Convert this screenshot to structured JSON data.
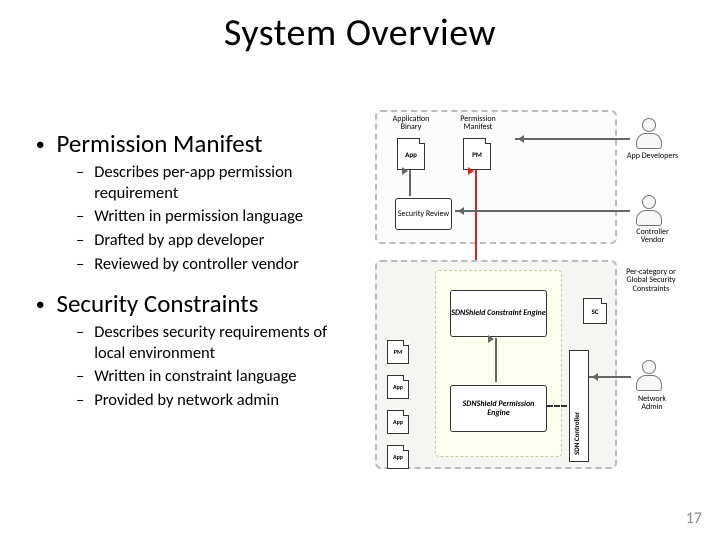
{
  "title": "System Overview",
  "sections": [
    {
      "heading": "Permission Manifest",
      "items": [
        "Describes per-app permission requirement",
        "Written in permission language",
        "Drafted by app developer",
        "Reviewed by controller vendor"
      ]
    },
    {
      "heading": "Security Constraints",
      "items": [
        "Describes security requirements of local environment",
        "Written in constraint language",
        "Provided by network admin"
      ]
    }
  ],
  "diagram": {
    "top_labels": {
      "app_binary": "Application\nBinary",
      "perm_manifest": "Permission\nManifest"
    },
    "actors": {
      "app_dev": "App\nDevelopers",
      "ctrl_vendor": "Controller\nVendor",
      "net_admin": "Network\nAdmin"
    },
    "boxes": {
      "app": "App",
      "pm": "PM",
      "sec_review": "Security\nReview",
      "constraint_engine": "SDNShield\nConstraint\nEngine",
      "permission_engine": "SDNShield\nPermission\nEngine",
      "sc": "SC",
      "sc_label": "Per-category\nor Global\nSecurity\nConstraints",
      "controller": "SDN Controller"
    }
  },
  "page_number": "17"
}
